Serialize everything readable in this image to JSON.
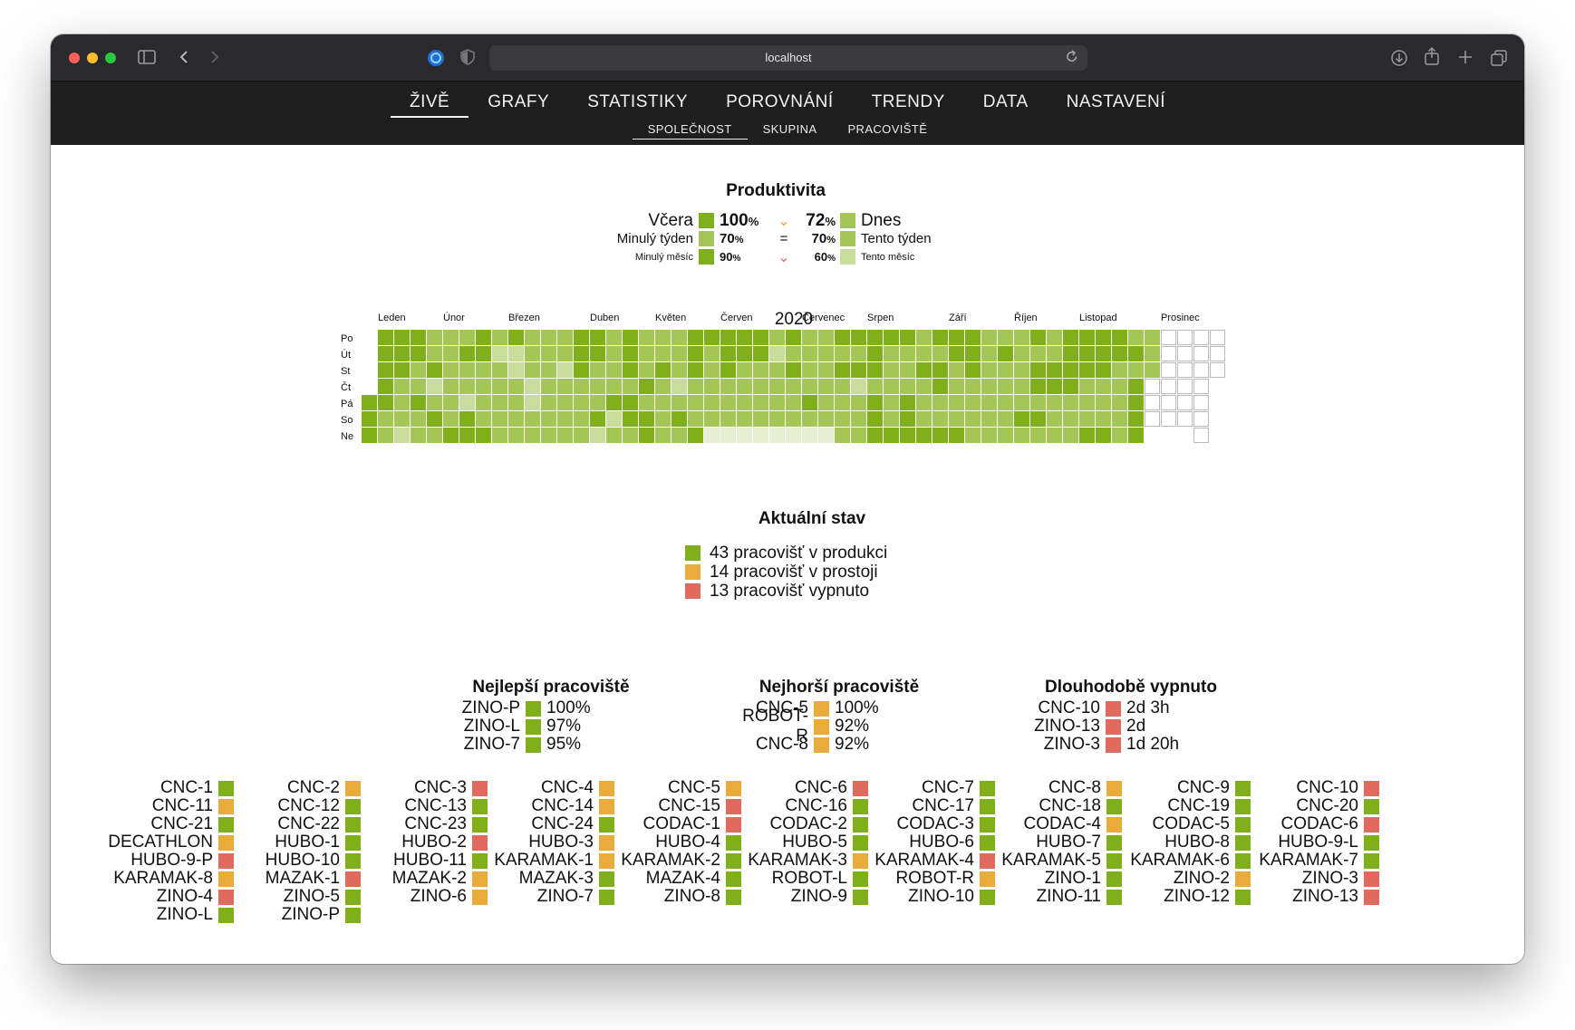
{
  "browser": {
    "url": "localhost",
    "icons": [
      "sidebar-icon",
      "back-icon",
      "forward-icon",
      "browser-logo-icon",
      "shield-icon",
      "reload-icon",
      "download-icon",
      "share-icon",
      "new-tab-icon",
      "tabs-overview-icon"
    ]
  },
  "nav": {
    "main": [
      {
        "label": "ŽIVĚ",
        "active": true
      },
      {
        "label": "GRAFY",
        "active": false
      },
      {
        "label": "STATISTIKY",
        "active": false
      },
      {
        "label": "POROVNÁNÍ",
        "active": false
      },
      {
        "label": "TRENDY",
        "active": false
      },
      {
        "label": "DATA",
        "active": false
      },
      {
        "label": "NASTAVENÍ",
        "active": false
      }
    ],
    "sub": [
      {
        "label": "SPOLEČNOST",
        "active": true
      },
      {
        "label": "SKUPINA",
        "active": false
      },
      {
        "label": "PRACOVIŠTĚ",
        "active": false
      }
    ]
  },
  "colors": {
    "dark_green": "#7faf1a",
    "mid_green": "#a3c656",
    "light_green": "#c8dd9b",
    "pale_green": "#e6efd2",
    "orange": "#e9ab3c",
    "red": "#e06a5e",
    "empty_border": "#b9b9b9"
  },
  "productivity": {
    "title": "Produktivita",
    "rows": [
      {
        "left_label": "Včera",
        "left_value": "100",
        "left_color": "#7faf1a",
        "compare": "⌄",
        "compare_color": "#e9ab3c",
        "right_value": "72",
        "right_color": "#a3c656",
        "right_label": "Dnes",
        "size": "large"
      },
      {
        "left_label": "Minulý týden",
        "left_value": "70",
        "left_color": "#a3c656",
        "compare": "=",
        "compare_color": "#111111",
        "right_value": "70",
        "right_color": "#a3c656",
        "right_label": "Tento týden",
        "size": "medium"
      },
      {
        "left_label": "Minulý měsíc",
        "left_value": "90",
        "left_color": "#7faf1a",
        "compare": "⌄",
        "compare_color": "#e06a5e",
        "right_value": "60",
        "right_color": "#c8dd9b",
        "right_label": "Tento měsíc",
        "size": "small"
      }
    ],
    "unit": "%"
  },
  "calendar": {
    "year": "2020",
    "months": [
      "Leden",
      "Únor",
      "Březen",
      "Duben",
      "Květen",
      "Červen",
      "Červenec",
      "Srpen",
      "Září",
      "Říjen",
      "Listopad",
      "Prosinec"
    ],
    "weekdays": [
      "Po",
      "Út",
      "St",
      "Čt",
      "Pá",
      "So",
      "Ne"
    ],
    "levels_by_week": [
      "    444",
      "4444433",
      "4443332",
      "4433433",
      "3342343",
      "3333334",
      "3433244",
      "4433334",
      "3233333",
      "4223333",
      "3332233",
      "3333333",
      "3323333",
      "4443333",
      "4433342",
      "3333423",
      "4443443",
      "3334344",
      "3343333",
      "3332343",
      "4443334",
      "4333331",
      "4443331",
      "4433331",
      "4433331",
      "3233331",
      "4343331",
      "3333431",
      "3333331",
      "4343333",
      "4342333",
      "4443444",
      "4333334",
      "4333444",
      "3343334",
      "4344334",
      "4433334",
      "4443333",
      "3333333",
      "3433333",
      "3333343",
      "4344343",
      "3344333",
      "4444333",
      "4443334",
      "4443334",
      "4433333",
      "3434444",
      "333000",
      "000000",
      "000000",
      "0000000",
      "000"
    ]
  },
  "status": {
    "title": "Aktuální stav",
    "items": [
      {
        "text": "43 pracovišť v produkci",
        "color": "#7faf1a"
      },
      {
        "text": "14 pracovišť v prostoji",
        "color": "#e9ab3c"
      },
      {
        "text": "13 pracovišť vypnuto",
        "color": "#e06a5e"
      }
    ]
  },
  "best": {
    "title": "Nejlepší pracoviště",
    "items": [
      {
        "name": "ZINO-P",
        "value": "100%",
        "color": "#7faf1a"
      },
      {
        "name": "ZINO-L",
        "value": "97%",
        "color": "#7faf1a"
      },
      {
        "name": "ZINO-7",
        "value": "95%",
        "color": "#7faf1a"
      }
    ]
  },
  "worst": {
    "title": "Nejhorší pracoviště",
    "items": [
      {
        "name": "CNC-5",
        "value": "100%",
        "color": "#e9ab3c"
      },
      {
        "name": "ROBOT-R",
        "value": "92%",
        "color": "#e9ab3c"
      },
      {
        "name": "CNC-8",
        "value": "92%",
        "color": "#e9ab3c"
      }
    ]
  },
  "longoff": {
    "title": "Dlouhodobě vypnuto",
    "items": [
      {
        "name": "CNC-10",
        "value": "2d 3h",
        "color": "#e06a5e"
      },
      {
        "name": "ZINO-13",
        "value": "2d",
        "color": "#e06a5e"
      },
      {
        "name": "ZINO-3",
        "value": "1d 20h",
        "color": "#e06a5e"
      }
    ]
  },
  "machines": [
    [
      [
        "CNC-1",
        "g"
      ],
      [
        "CNC-11",
        "o"
      ],
      [
        "CNC-21",
        "g"
      ],
      [
        "DECATHLON",
        "o"
      ],
      [
        "HUBO-9-P",
        "r"
      ],
      [
        "KARAMAK-8",
        "o"
      ],
      [
        "ZINO-4",
        "r"
      ],
      [
        "ZINO-L",
        "g"
      ]
    ],
    [
      [
        "CNC-2",
        "o"
      ],
      [
        "CNC-12",
        "g"
      ],
      [
        "CNC-22",
        "g"
      ],
      [
        "HUBO-1",
        "g"
      ],
      [
        "HUBO-10",
        "g"
      ],
      [
        "MAZAK-1",
        "r"
      ],
      [
        "ZINO-5",
        "g"
      ],
      [
        "ZINO-P",
        "g"
      ]
    ],
    [
      [
        "CNC-3",
        "r"
      ],
      [
        "CNC-13",
        "g"
      ],
      [
        "CNC-23",
        "g"
      ],
      [
        "HUBO-2",
        "r"
      ],
      [
        "HUBO-11",
        "g"
      ],
      [
        "MAZAK-2",
        "o"
      ],
      [
        "ZINO-6",
        "o"
      ]
    ],
    [
      [
        "CNC-4",
        "o"
      ],
      [
        "CNC-14",
        "o"
      ],
      [
        "CNC-24",
        "g"
      ],
      [
        "HUBO-3",
        "o"
      ],
      [
        "KARAMAK-1",
        "o"
      ],
      [
        "MAZAK-3",
        "g"
      ],
      [
        "ZINO-7",
        "g"
      ]
    ],
    [
      [
        "CNC-5",
        "o"
      ],
      [
        "CNC-15",
        "r"
      ],
      [
        "CODAC-1",
        "r"
      ],
      [
        "HUBO-4",
        "g"
      ],
      [
        "KARAMAK-2",
        "g"
      ],
      [
        "MAZAK-4",
        "g"
      ],
      [
        "ZINO-8",
        "g"
      ]
    ],
    [
      [
        "CNC-6",
        "r"
      ],
      [
        "CNC-16",
        "g"
      ],
      [
        "CODAC-2",
        "g"
      ],
      [
        "HUBO-5",
        "g"
      ],
      [
        "KARAMAK-3",
        "o"
      ],
      [
        "ROBOT-L",
        "g"
      ],
      [
        "ZINO-9",
        "g"
      ]
    ],
    [
      [
        "CNC-7",
        "g"
      ],
      [
        "CNC-17",
        "g"
      ],
      [
        "CODAC-3",
        "g"
      ],
      [
        "HUBO-6",
        "g"
      ],
      [
        "KARAMAK-4",
        "r"
      ],
      [
        "ROBOT-R",
        "o"
      ],
      [
        "ZINO-10",
        "g"
      ]
    ],
    [
      [
        "CNC-8",
        "o"
      ],
      [
        "CNC-18",
        "g"
      ],
      [
        "CODAC-4",
        "o"
      ],
      [
        "HUBO-7",
        "g"
      ],
      [
        "KARAMAK-5",
        "g"
      ],
      [
        "ZINO-1",
        "g"
      ],
      [
        "ZINO-11",
        "g"
      ]
    ],
    [
      [
        "CNC-9",
        "g"
      ],
      [
        "CNC-19",
        "g"
      ],
      [
        "CODAC-5",
        "g"
      ],
      [
        "HUBO-8",
        "g"
      ],
      [
        "KARAMAK-6",
        "g"
      ],
      [
        "ZINO-2",
        "o"
      ],
      [
        "ZINO-12",
        "g"
      ]
    ],
    [
      [
        "CNC-10",
        "r"
      ],
      [
        "CNC-20",
        "g"
      ],
      [
        "CODAC-6",
        "r"
      ],
      [
        "HUBO-9-L",
        "g"
      ],
      [
        "KARAMAK-7",
        "g"
      ],
      [
        "ZINO-3",
        "r"
      ],
      [
        "ZINO-13",
        "r"
      ]
    ]
  ]
}
